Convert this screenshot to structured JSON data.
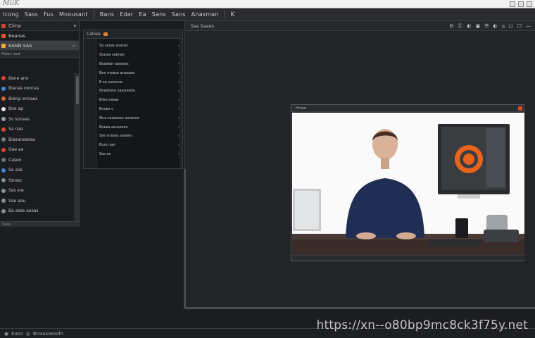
{
  "app": {
    "title": "MiiK",
    "colors": {
      "accent": "#d4462a",
      "panel": "#1b1c1f",
      "workspace": "#232428",
      "video_bg": "#fafafa"
    }
  },
  "menubar": {
    "items": [
      "Icong",
      "Sass",
      "Fus",
      "Mnousant",
      "Bans",
      "Edar",
      "Ea",
      "Sans",
      "Sans",
      "Anasman"
    ],
    "icon": "K"
  },
  "left_panel": {
    "header_label": "Cima",
    "rows": [
      {
        "label": "Beanas",
        "selected": false
      },
      {
        "label": "BANN SAS",
        "selected": true
      }
    ],
    "sub_label": "Pelan asd",
    "items": [
      "Bene ann",
      "Bianas onoces",
      "Brenp ennaes",
      "Bne ap",
      "Sv sonses",
      "Sa nao",
      "Biasaneseaa",
      "Gae aa",
      "Casen",
      "Sa aas",
      "Ssrasc",
      "Sas sre",
      "Sae aau",
      "Ba asse aesas"
    ],
    "footer_label": "Sasa"
  },
  "mid_panel": {
    "header_label": "Calnes",
    "rows": [
      "Sa sasas snaces",
      "Stasas saenes",
      "Beasear aassses",
      "Ben mease anaaaes",
      "B sa sanacca",
      "Bneshsne sassreenu",
      "Breu saaas",
      "Bnoes v",
      "Stra seaasses ansarssr",
      "Bnesa aeussens",
      "Sas sneses sanaes",
      "Bunn san",
      "Sas as"
    ]
  },
  "workspace": {
    "toolbar_label": "Sas Saaes",
    "tools": [
      "⊟",
      "Ⓒ",
      "◐",
      "▣",
      "☰",
      "◐",
      "⌂",
      "◻",
      "☐",
      "—"
    ]
  },
  "video_window": {
    "title": "Hnaat",
    "logo_color": "#e8641e"
  },
  "statusbar": {
    "labels": [
      "Easo",
      "Boaasaeadn"
    ]
  },
  "watermark": "https://xn--o80bp9mc8ck3f75y.net"
}
